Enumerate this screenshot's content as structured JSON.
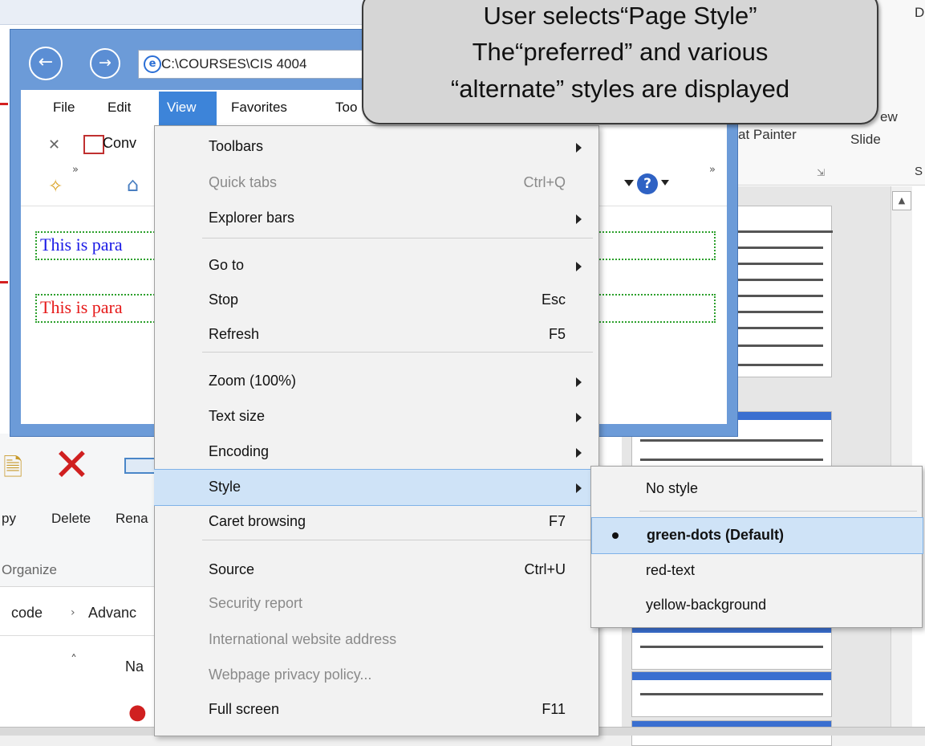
{
  "callout": {
    "line1": "User selects“Page Style”",
    "line2": "The“preferred” and various",
    "line3": "“alternate” styles are displayed"
  },
  "ie": {
    "address": "C:\\COURSES\\CIS 4004",
    "menubar": {
      "file": "File",
      "edit": "Edit",
      "view": "View",
      "favorites": "Favorites",
      "tools": "Too"
    },
    "cmdbar": {
      "convert": "Conv"
    },
    "content": {
      "para1": "This is para",
      "para1_color": "#1a1ae6",
      "para2": "This is para",
      "para2_color": "#e61a1a"
    }
  },
  "view_menu": {
    "items": [
      {
        "label": "Toolbars",
        "shortcut": "",
        "submenu": true,
        "disabled": false
      },
      {
        "label": "Quick tabs",
        "shortcut": "Ctrl+Q",
        "submenu": false,
        "disabled": true
      },
      {
        "label": "Explorer bars",
        "shortcut": "",
        "submenu": true,
        "disabled": false
      },
      {
        "label": "Go to",
        "shortcut": "",
        "submenu": true,
        "disabled": false
      },
      {
        "label": "Stop",
        "shortcut": "Esc",
        "submenu": false,
        "disabled": false
      },
      {
        "label": "Refresh",
        "shortcut": "F5",
        "submenu": false,
        "disabled": false
      },
      {
        "label": "Zoom (100%)",
        "shortcut": "",
        "submenu": true,
        "disabled": false
      },
      {
        "label": "Text size",
        "shortcut": "",
        "submenu": true,
        "disabled": false
      },
      {
        "label": "Encoding",
        "shortcut": "",
        "submenu": true,
        "disabled": false
      },
      {
        "label": "Style",
        "shortcut": "",
        "submenu": true,
        "disabled": false
      },
      {
        "label": "Caret browsing",
        "shortcut": "F7",
        "submenu": false,
        "disabled": false
      },
      {
        "label": "Source",
        "shortcut": "Ctrl+U",
        "submenu": false,
        "disabled": false
      },
      {
        "label": "Security report",
        "shortcut": "",
        "submenu": false,
        "disabled": true
      },
      {
        "label": "International website address",
        "shortcut": "",
        "submenu": false,
        "disabled": true
      },
      {
        "label": "Webpage privacy policy...",
        "shortcut": "",
        "submenu": false,
        "disabled": true
      },
      {
        "label": "Full screen",
        "shortcut": "F11",
        "submenu": false,
        "disabled": false
      }
    ],
    "highlighted": "Style"
  },
  "style_submenu": {
    "items": [
      {
        "label": "No style",
        "selected": false
      },
      {
        "label": "green-dots (Default)",
        "selected": true
      },
      {
        "label": "red-text",
        "selected": false
      },
      {
        "label": "yellow-background",
        "selected": false
      }
    ]
  },
  "explorer": {
    "delete_label": "Delete",
    "rename_label": "Rena",
    "copy_label": "py",
    "organize_label": "Organize",
    "breadcrumb_code": "code",
    "breadcrumb_advanced": "Advanc",
    "name_header": "Na"
  },
  "ppt": {
    "format_painter": "at Painter",
    "new_slide": "Slide",
    "new_label": "ew",
    "section_s": "S",
    "top_d": "D"
  },
  "colors": {
    "accent": "#3d84d9",
    "menu_highlight": "#cfe3f7",
    "ie_frame": "#6c9bd8"
  }
}
